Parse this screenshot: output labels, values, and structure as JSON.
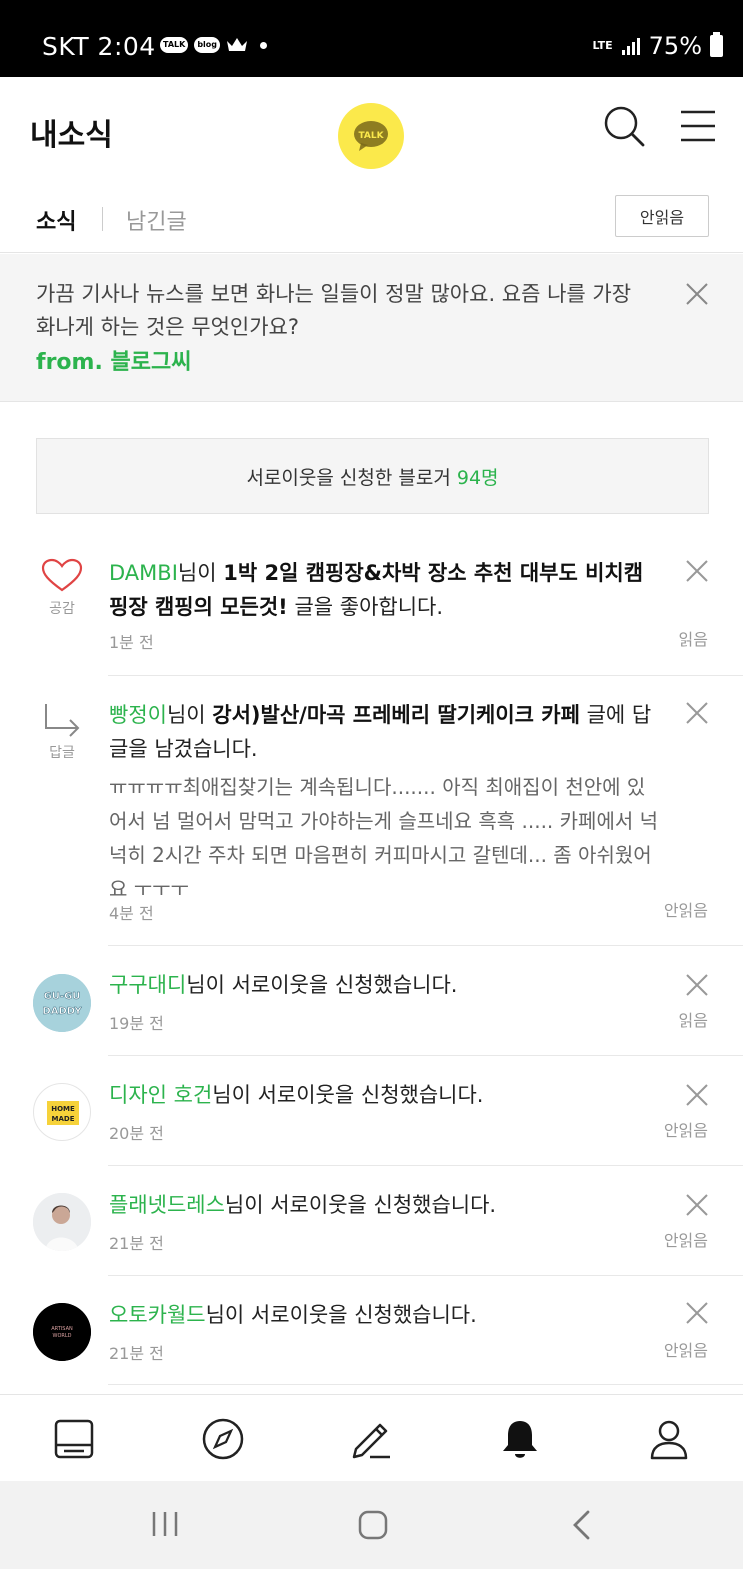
{
  "status_bar": {
    "carrier_time": "SKT 2:04",
    "notif_talk": "TALK",
    "notif_blog": "blog",
    "network": "LTE",
    "battery": "75%"
  },
  "header": {
    "title": "내소식",
    "talk_label": "TALK"
  },
  "tabs": {
    "news": "소식",
    "left_posts": "남긴글",
    "unread_button": "안읽음"
  },
  "banner": {
    "text": "가끔 기사나 뉴스를 보면 화나는 일들이 정말 많아요. 요즘 나를 가장 화나게 하는 것은 무엇인가요?",
    "from": "from. 블로그씨"
  },
  "neighbor_box": {
    "text": "서로이웃을 신청한 블로거",
    "count": "94명"
  },
  "feed": [
    {
      "user": "DAMBI",
      "suffix": "님이 ",
      "post": "1박 2일 캠핑장&차박 장소 추천 대부도 비치캠핑장 캠핑의 모든것!",
      "action": " 글을 좋아합니다.",
      "time": "1분 전",
      "status": "읽음",
      "side_label": "공감"
    },
    {
      "user": "빵정이",
      "suffix": "님이 ",
      "post": "강서)발산/마곡 프레베리 딸기케이크 카페",
      "action": " 글에 답글을 남겼습니다.",
      "excerpt": "ㅠㅠㅠㅠ최애집찾기는 계속됩니다....... 아직 최애집이 천안에 있어서 넘 멀어서 맘먹고 가야하는게 슬프네요 흑흑 ..... 카페에서 넉넉히 2시간 주차 되면 마음편히 커피마시고 갈텐데... 좀 아쉬웠어요 ㅜㅜㅜ",
      "time": "4분 전",
      "status": "안읽음",
      "side_label": "답글"
    },
    {
      "user": "구구대디",
      "action": "님이 서로이웃을 신청했습니다.",
      "time": "19분 전",
      "status": "읽음",
      "avatar_text": "GU-GU DADDY"
    },
    {
      "user": "디자인 호건",
      "action": "님이 서로이웃을 신청했습니다.",
      "time": "20분 전",
      "status": "안읽음",
      "avatar_text": "HOME MADE"
    },
    {
      "user": "플래넷드레스",
      "action": "님이 서로이웃을 신청했습니다.",
      "time": "21분 전",
      "status": "안읽음"
    },
    {
      "user": "오토카월드",
      "action": "님이 서로이웃을 신청했습니다.",
      "time": "21분 전",
      "status": "안읽음",
      "avatar_text": "ARTISAN WORLD"
    }
  ],
  "icons": {
    "heart": "heart-icon",
    "reply": "reply-arrow-icon",
    "close": "close-icon",
    "search": "search-icon",
    "menu": "hamburger-menu-icon",
    "nav": [
      "feed-icon",
      "compass-icon",
      "pencil-icon",
      "bell-icon",
      "profile-icon"
    ]
  },
  "colors": {
    "accent_green": "#2cb34d",
    "talk_yellow": "#fbe94b",
    "heart_red": "#e04444"
  }
}
